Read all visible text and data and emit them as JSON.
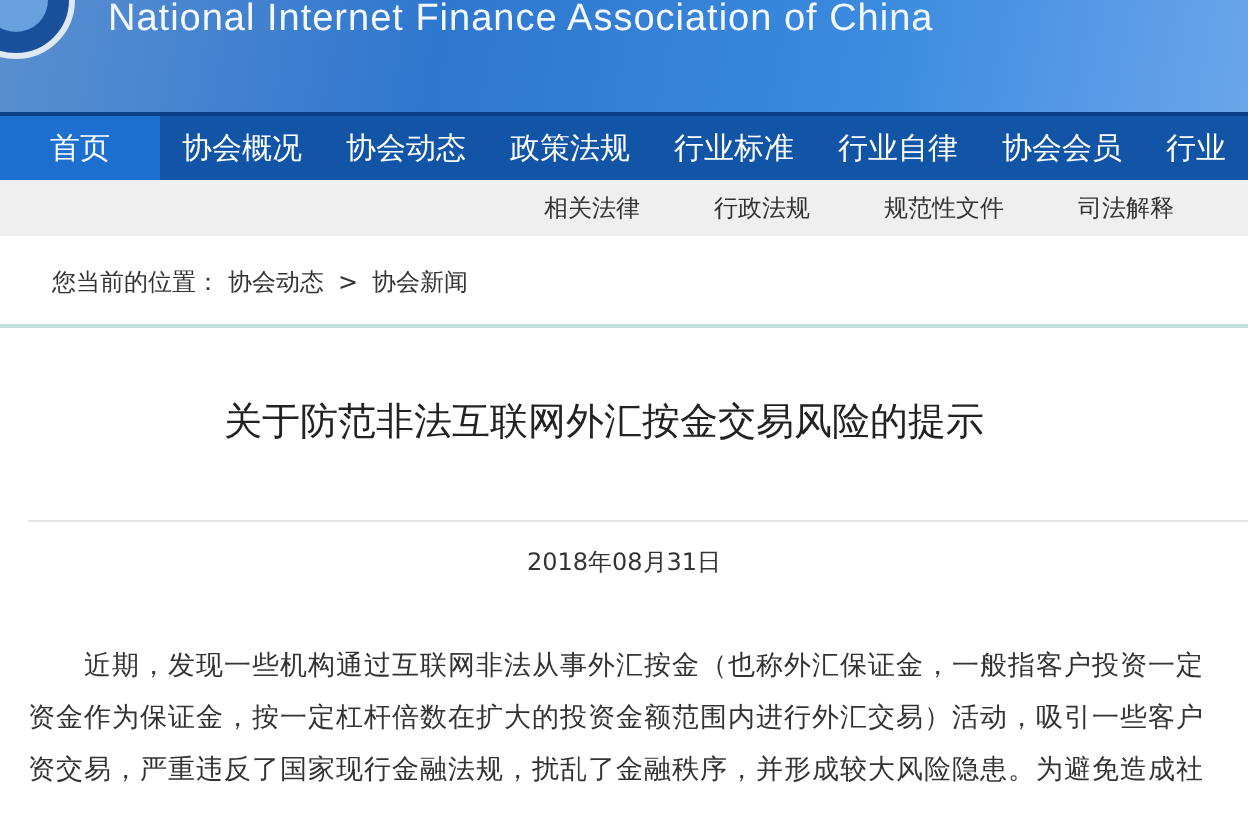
{
  "banner": {
    "title": "National Internet Finance Association of China"
  },
  "nav": [
    {
      "label": "首页",
      "selected": true
    },
    {
      "label": "协会概况",
      "selected": false
    },
    {
      "label": "协会动态",
      "selected": false
    },
    {
      "label": "政策法规",
      "selected": false
    },
    {
      "label": "行业标准",
      "selected": false
    },
    {
      "label": "行业自律",
      "selected": false
    },
    {
      "label": "协会会员",
      "selected": false
    },
    {
      "label": "行业",
      "selected": false
    }
  ],
  "subnav": [
    "相关法律",
    "行政法规",
    "规范性文件",
    "司法解释"
  ],
  "breadcrumb": {
    "prefix": "您当前的位置：",
    "items": [
      "协会动态",
      "协会新闻"
    ],
    "separator": ">"
  },
  "article": {
    "title": "关于防范非法互联网外汇按金交易风险的提示",
    "date": "2018年08月31日",
    "paragraph_lines": [
      "近期，发现一些机构通过互联网非法从事外汇按金（也称外汇保证金，一般指客户投资一定",
      "资金作为保证金，按一定杠杆倍数在扩大的投资金额范围内进行外汇交易）活动，吸引一些客户",
      "资交易，严重违反了国家现行金融法规，扰乱了金融秩序，并形成较大风险隐患。为避免造成社"
    ]
  }
}
